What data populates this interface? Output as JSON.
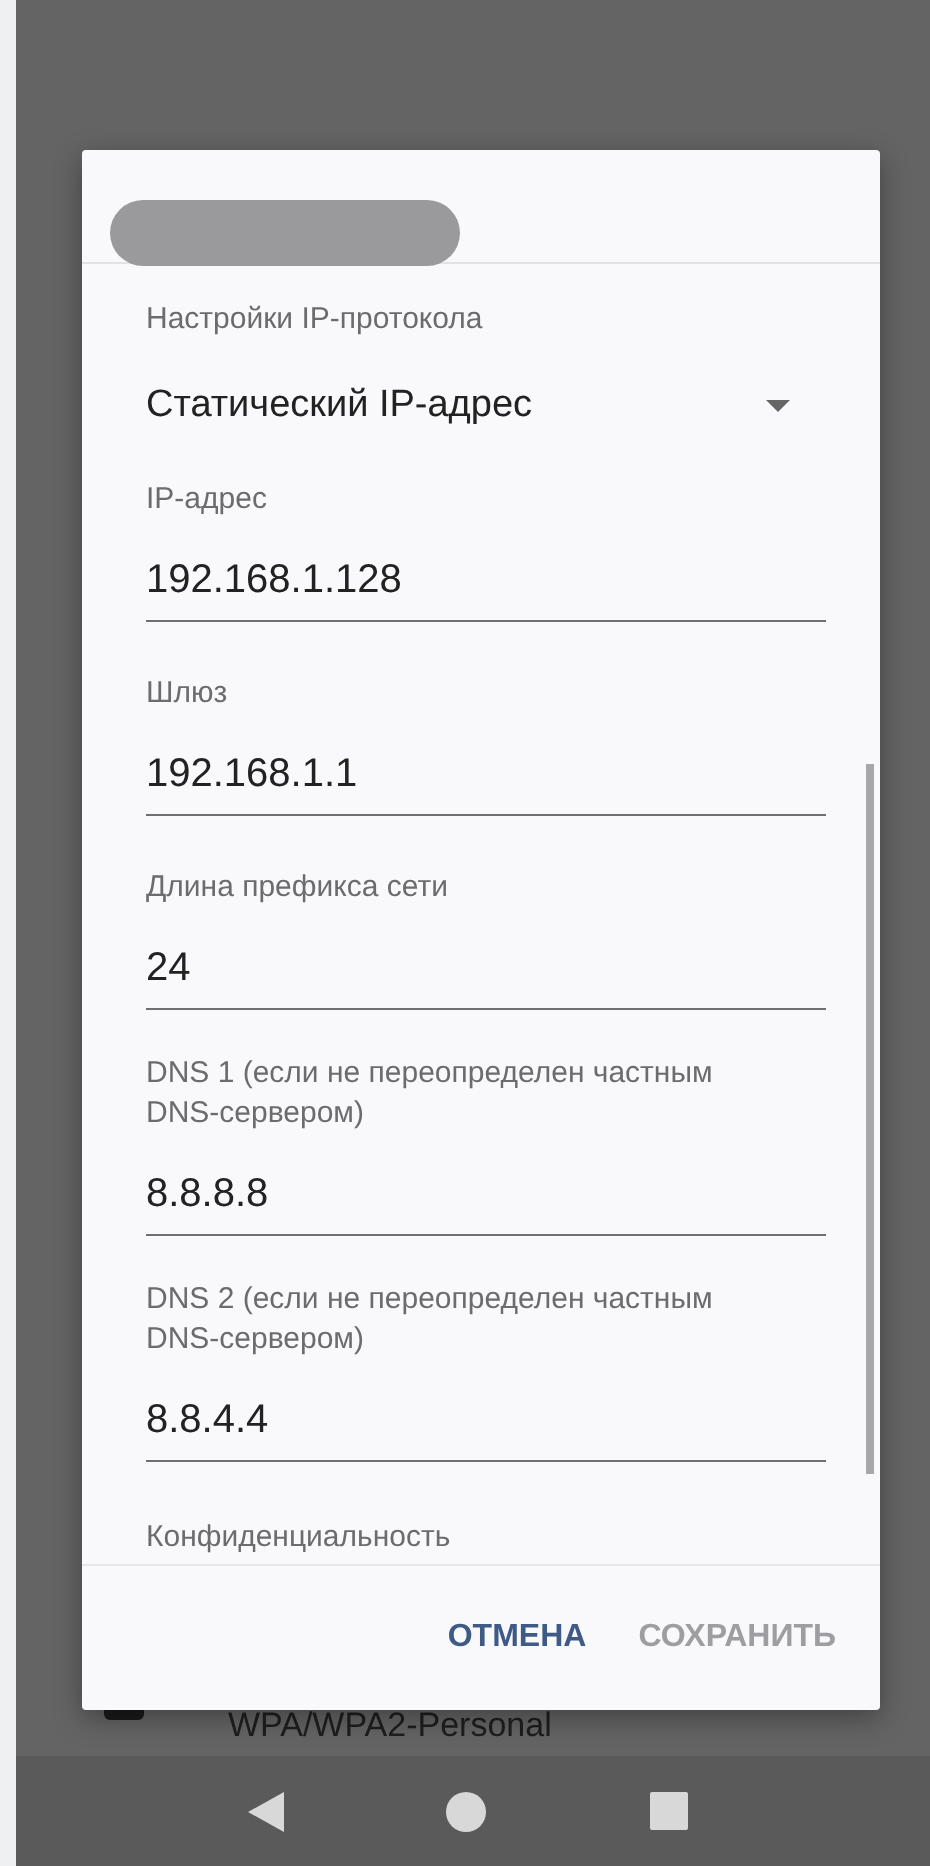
{
  "background": {
    "network_security": "WPA/WPA2-Personal"
  },
  "dialog": {
    "ip_settings": {
      "label": "Настройки IP-протокола",
      "value": "Статический IP-адрес"
    },
    "fields": [
      {
        "label": "IP-адрес",
        "value": "192.168.1.128"
      },
      {
        "label": "Шлюз",
        "value": "192.168.1.1"
      },
      {
        "label": "Длина префикса сети",
        "value": "24"
      },
      {
        "label": "DNS 1 (если не переопределен частным DNS-сервером)",
        "value": "8.8.8.8"
      },
      {
        "label": "DNS 2 (если не переопределен частным DNS-сервером)",
        "value": "8.8.4.4"
      }
    ],
    "next_section": "Конфиденциальность",
    "buttons": [
      {
        "label": "ОТМЕНА",
        "disabled": false
      },
      {
        "label": "СОХРАНИТЬ",
        "disabled": true
      }
    ]
  }
}
